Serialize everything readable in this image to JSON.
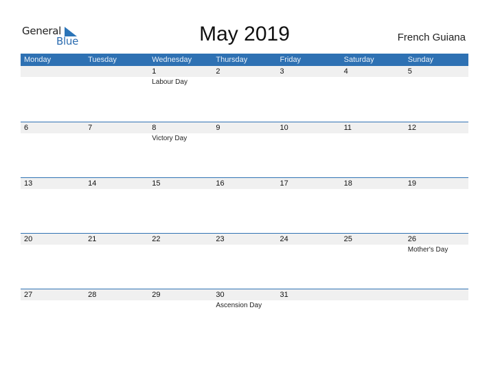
{
  "logo": {
    "text_general": "General",
    "text_blue": "Blue",
    "icon": "triangle-flag-icon"
  },
  "title": "May 2019",
  "country": "French Guiana",
  "colors": {
    "header_bg": "#2e71b3",
    "row_bg": "#f0f0f0",
    "accent": "#2e71b3"
  },
  "weekdays": [
    "Monday",
    "Tuesday",
    "Wednesday",
    "Thursday",
    "Friday",
    "Saturday",
    "Sunday"
  ],
  "weeks": [
    [
      {
        "day": "",
        "holiday": ""
      },
      {
        "day": "",
        "holiday": ""
      },
      {
        "day": "1",
        "holiday": "Labour Day"
      },
      {
        "day": "2",
        "holiday": ""
      },
      {
        "day": "3",
        "holiday": ""
      },
      {
        "day": "4",
        "holiday": ""
      },
      {
        "day": "5",
        "holiday": ""
      }
    ],
    [
      {
        "day": "6",
        "holiday": ""
      },
      {
        "day": "7",
        "holiday": ""
      },
      {
        "day": "8",
        "holiday": "Victory Day"
      },
      {
        "day": "9",
        "holiday": ""
      },
      {
        "day": "10",
        "holiday": ""
      },
      {
        "day": "11",
        "holiday": ""
      },
      {
        "day": "12",
        "holiday": ""
      }
    ],
    [
      {
        "day": "13",
        "holiday": ""
      },
      {
        "day": "14",
        "holiday": ""
      },
      {
        "day": "15",
        "holiday": ""
      },
      {
        "day": "16",
        "holiday": ""
      },
      {
        "day": "17",
        "holiday": ""
      },
      {
        "day": "18",
        "holiday": ""
      },
      {
        "day": "19",
        "holiday": ""
      }
    ],
    [
      {
        "day": "20",
        "holiday": ""
      },
      {
        "day": "21",
        "holiday": ""
      },
      {
        "day": "22",
        "holiday": ""
      },
      {
        "day": "23",
        "holiday": ""
      },
      {
        "day": "24",
        "holiday": ""
      },
      {
        "day": "25",
        "holiday": ""
      },
      {
        "day": "26",
        "holiday": "Mother's Day"
      }
    ],
    [
      {
        "day": "27",
        "holiday": ""
      },
      {
        "day": "28",
        "holiday": ""
      },
      {
        "day": "29",
        "holiday": ""
      },
      {
        "day": "30",
        "holiday": "Ascension Day"
      },
      {
        "day": "31",
        "holiday": ""
      },
      {
        "day": "",
        "holiday": ""
      },
      {
        "day": "",
        "holiday": ""
      }
    ]
  ]
}
